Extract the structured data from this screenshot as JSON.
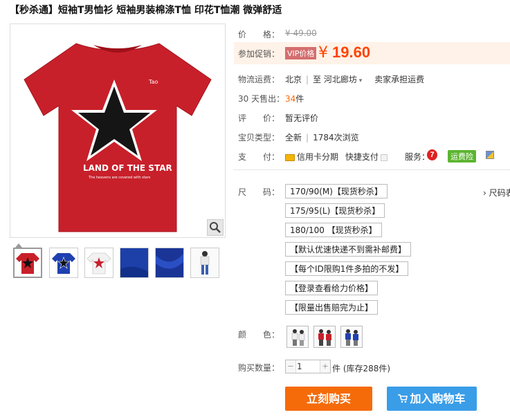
{
  "title": "【秒杀通】短袖T男恤衫 短袖男装棉涤T恤 印花T恤潮 微弹舒适",
  "colors": {
    "accent": "#ff4400",
    "buy": "#f56b0a",
    "cart": "#3a9de8",
    "vip": "#d56e6e",
    "badge": "#5cb531"
  },
  "product_image": {
    "shirt_color": "#c8202a",
    "print_text": "LAND OF THE STAR",
    "print_subtext": "The heavens are covered with stars",
    "tao": "Tao",
    "zoom_icon": "magnifier-icon"
  },
  "thumbnails": [
    {
      "name": "red tee"
    },
    {
      "name": "blue tee"
    },
    {
      "name": "white tee"
    },
    {
      "name": "blue fabric"
    },
    {
      "name": "blue fabric detail"
    },
    {
      "name": "model"
    }
  ],
  "price": {
    "label": "价　　格：",
    "original": "¥ 49.00"
  },
  "promo": {
    "label": "参加促销：",
    "vip": "VIP价格",
    "currency": "¥",
    "amount": "19.60"
  },
  "shipping": {
    "label": "物流运费：",
    "from": "北京",
    "to": "至",
    "dest": "河北廊坊",
    "fee": "卖家承担运费"
  },
  "sales": {
    "label": "30 天售出：",
    "count": "34",
    "unit": "件"
  },
  "rating": {
    "label": "评　　价：",
    "value": "暂无评价"
  },
  "condition": {
    "label": "宝贝类型：",
    "value": "全新",
    "views": "1784次浏览"
  },
  "payment": {
    "label": "支　　付：",
    "credit": "信用卡分期",
    "quick": "快捷支付",
    "service_label": "服务：",
    "seven": "7",
    "insurance": "运费险"
  },
  "size": {
    "label": "尺　　码：",
    "chart": "› 尺码表",
    "options": [
      "170/90(M)【现货秒杀】",
      "175/95(L)【现货秒杀】",
      "180/100 【现货秒杀】",
      "【默认优速快递不到需补邮费】",
      "【每个ID限购1件多拍的不发】",
      "【登录查看给力价格】",
      "【限量出售赔完为止】"
    ]
  },
  "color": {
    "label": "颜　　色："
  },
  "quantity": {
    "label": "购买数量：",
    "value": "1",
    "minus": "−",
    "plus": "+",
    "stock": "件 (库存288件)"
  },
  "buttons": {
    "buy": "立刻购买",
    "cart": "加入购物车"
  }
}
